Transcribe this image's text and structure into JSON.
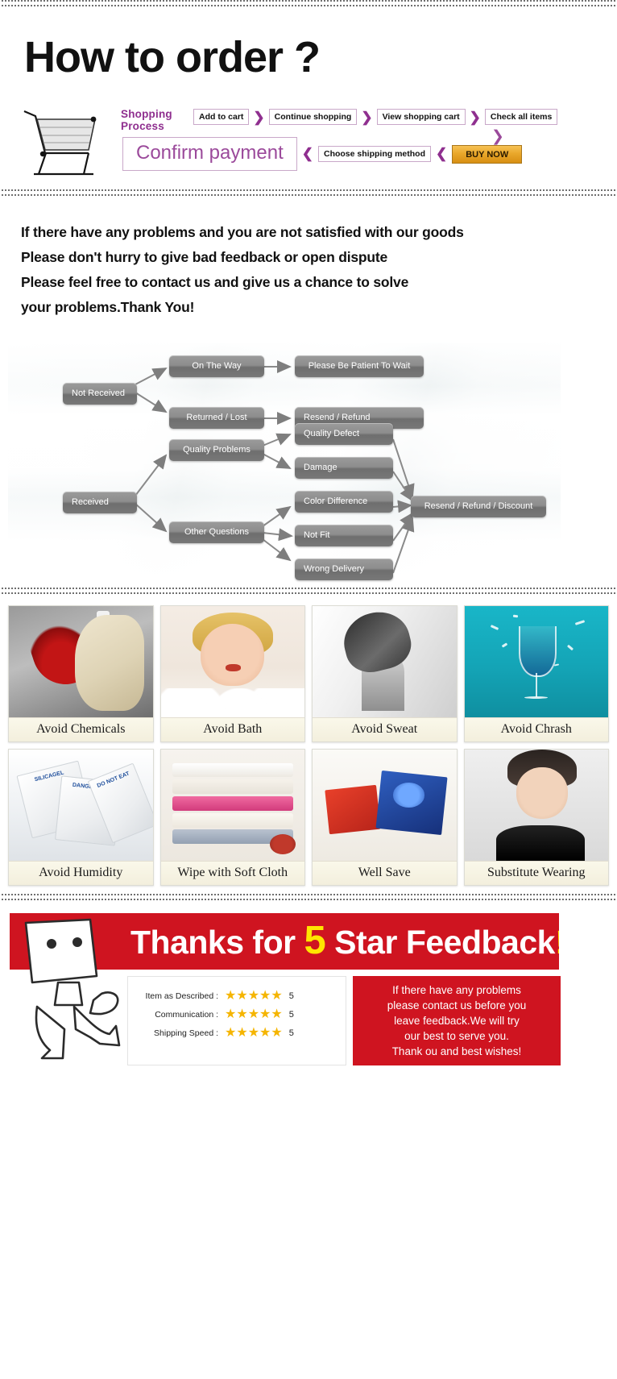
{
  "order_section": {
    "headline": "How to order ?",
    "process_label_line1": "Shopping",
    "process_label_line2": "Process",
    "steps_row1": [
      "Add to cart",
      "Continue shopping",
      "View shopping cart",
      "Check all items"
    ],
    "confirm_label": "Confirm payment",
    "steps_row2": [
      "Choose shipping method"
    ],
    "buy_now_label": "BUY NOW",
    "accent_color": "#8f2f8f",
    "buy_now_color": "#e9a72b"
  },
  "message_section": {
    "lines": [
      "If there have any problems and you are not satisfied with our goods",
      "Please don't hurry to give bad feedback or open dispute",
      "Please feel free to contact us and give us a chance to solve",
      "your problems.Thank You!"
    ]
  },
  "flowchart": {
    "nodes": {
      "not_received": "Not Received",
      "on_the_way": "On The Way",
      "returned_lost": "Returned / Lost",
      "please_wait": "Please Be Patient To Wait",
      "resend_refund": "Resend / Refund",
      "received": "Received",
      "quality_problems": "Quality Problems",
      "other_questions": "Other Questions",
      "quality_defect": "Quality Defect",
      "damage": "Damage",
      "color_difference": "Color Difference",
      "not_fit": "Not Fit",
      "wrong_delivery": "Wrong Delivery",
      "resend_refund_discount": "Resend / Refund / Discount"
    }
  },
  "care_grid": {
    "row1": [
      {
        "caption": "Avoid Chemicals",
        "icon": "chemicals-icon"
      },
      {
        "caption": "Avoid Bath",
        "icon": "bath-icon"
      },
      {
        "caption": "Avoid Sweat",
        "icon": "sweat-icon"
      },
      {
        "caption": "Avoid Chrash",
        "icon": "crash-icon"
      }
    ],
    "row2": [
      {
        "caption": "Avoid Humidity",
        "icon": "humidity-icon"
      },
      {
        "caption": "Wipe with Soft Cloth",
        "icon": "cloth-icon"
      },
      {
        "caption": "Well Save",
        "icon": "storage-icon"
      },
      {
        "caption": "Substitute Wearing",
        "icon": "wearing-icon"
      }
    ],
    "silica_text": [
      "SILICAGEL",
      "DANGEROUS",
      "DO NOT EAT"
    ]
  },
  "feedback": {
    "title_before": "Thanks for",
    "title_five": "5",
    "title_after": "Star Feedback",
    "title_bang": "!",
    "banner_color": "#cf1420",
    "five_color": "#ffe500",
    "ratings": [
      {
        "label": "Item as Described :",
        "stars": "★★★★★",
        "score": "5"
      },
      {
        "label": "Communication :",
        "stars": "★★★★★",
        "score": "5"
      },
      {
        "label": "Shipping Speed :",
        "stars": "★★★★★",
        "score": "5"
      }
    ],
    "note_lines": [
      "If there have any problems",
      "please contact us before you",
      "leave feedback.We will try",
      "our best to serve you.",
      "Thank ou and best wishes!"
    ],
    "star_color": "#f5b500"
  }
}
